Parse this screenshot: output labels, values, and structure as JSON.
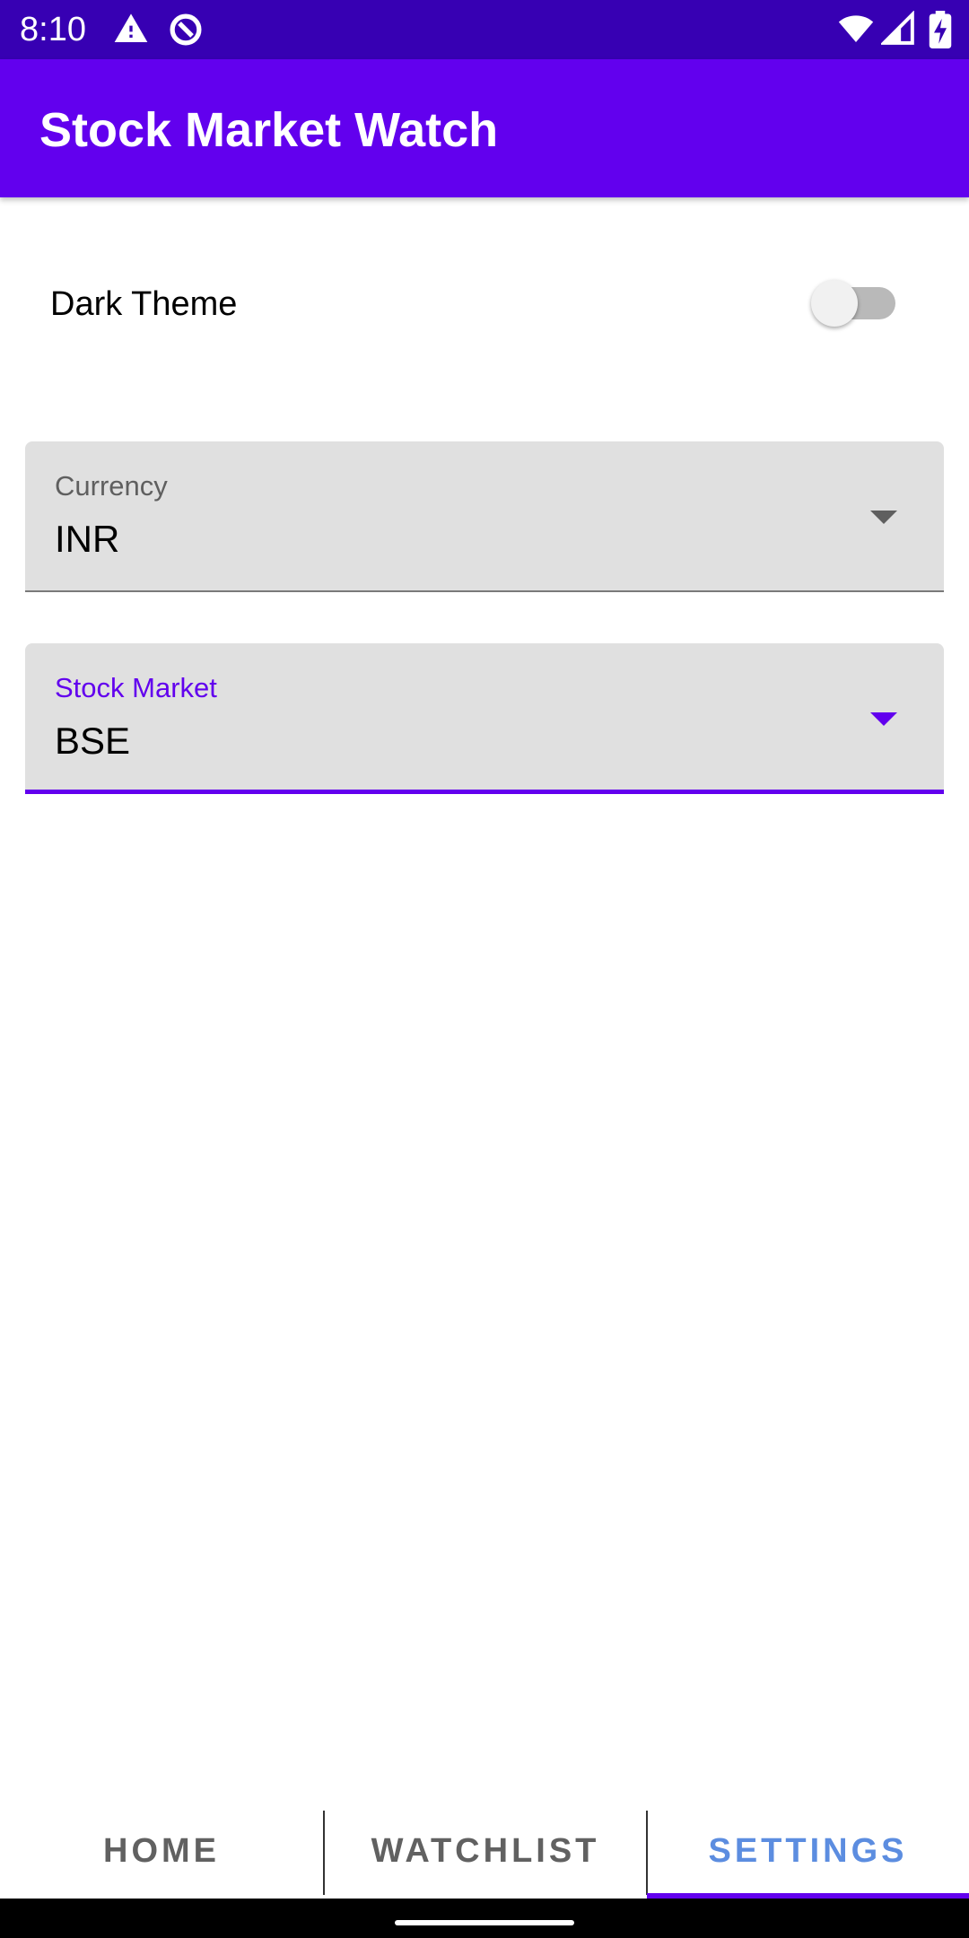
{
  "status_bar": {
    "time": "8:10",
    "left_icons": [
      "warning-icon",
      "data-saver-icon"
    ],
    "right_icons": [
      "wifi-icon",
      "cell-signal-icon",
      "battery-charging-icon"
    ]
  },
  "app_bar": {
    "title": "Stock Market Watch"
  },
  "settings": {
    "dark_theme": {
      "label": "Dark Theme",
      "enabled": false
    },
    "currency": {
      "label": "Currency",
      "value": "INR"
    },
    "stock_market": {
      "label": "Stock Market",
      "value": "BSE",
      "focused": true
    }
  },
  "tabs": [
    {
      "label": "HOME",
      "selected": false
    },
    {
      "label": "WATCHLIST",
      "selected": false
    },
    {
      "label": "SETTINGS",
      "selected": true
    }
  ],
  "colors": {
    "primary": "#6200ee",
    "primary_dark": "#3700b3",
    "selected_tab_text": "#5c8de0",
    "field_background": "#e0e0e0"
  }
}
